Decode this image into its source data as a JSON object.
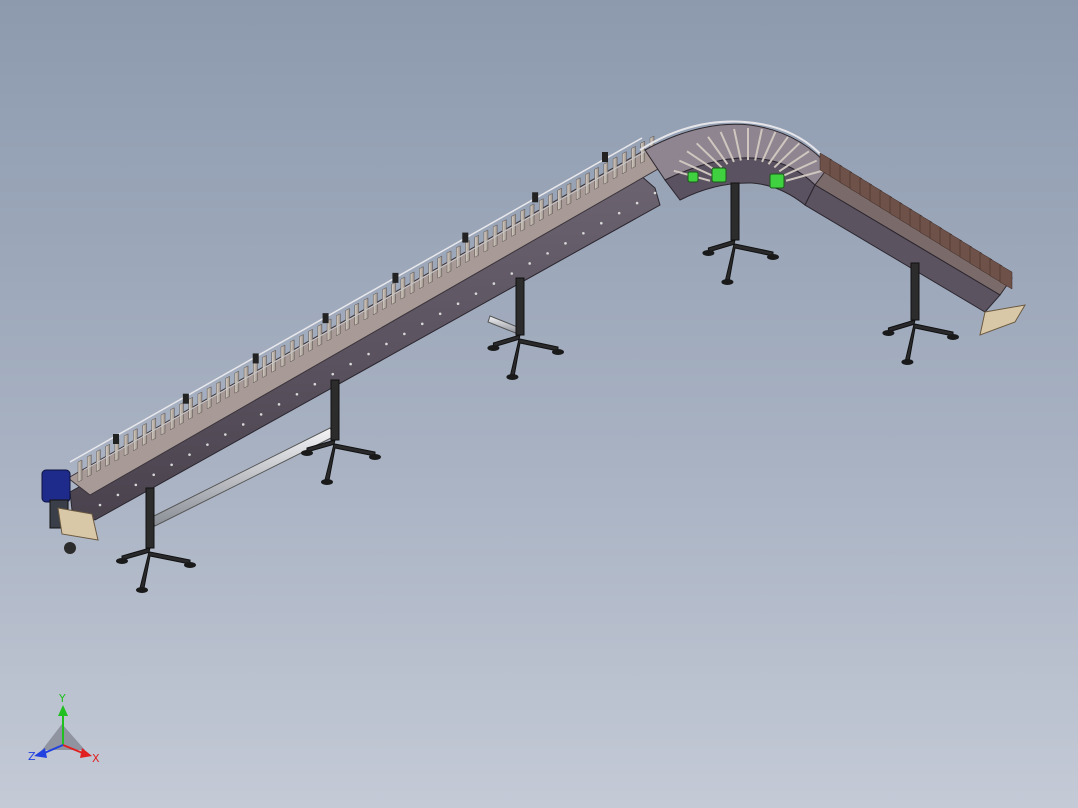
{
  "viewport": {
    "background_top": "#8d9aae",
    "background_bottom": "#c4cad6"
  },
  "model": {
    "description_icon": "conveyor-3d-model",
    "frame_color": "#5e5560",
    "slat_color": "#cfc7bf",
    "leg_color": "#2c2c2c",
    "motor_color": "#1f2b8a",
    "accent_green": "#3fd13f"
  },
  "triad": {
    "x_label": "X",
    "y_label": "Y",
    "z_label": "Z",
    "x_color": "#e02020",
    "y_color": "#20c020",
    "z_color": "#2040e0"
  }
}
